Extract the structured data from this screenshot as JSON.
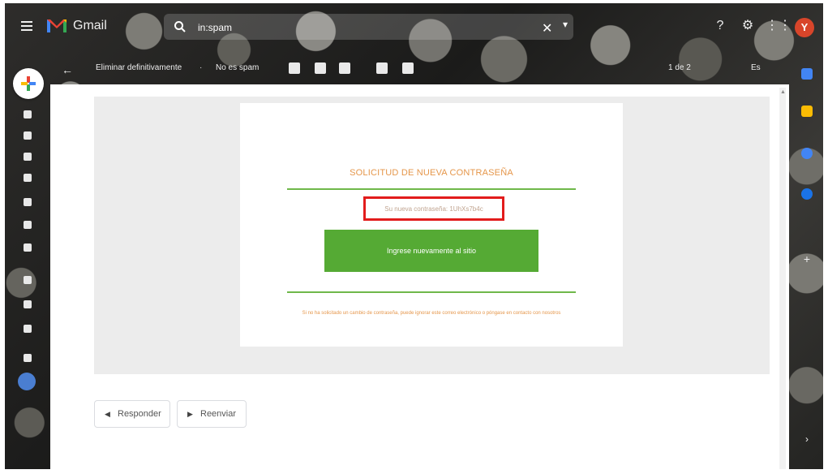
{
  "app": {
    "name": "Gmail",
    "avatar_initial": "Y"
  },
  "search": {
    "value": "in:spam"
  },
  "toolbar": {
    "label_delete": "Eliminar definitivamente",
    "label_not_spam": "No es spam",
    "count": "1 de 2",
    "lang": "Es"
  },
  "email": {
    "title": "SOLICITUD DE NUEVA CONTRASEÑA",
    "password_line": "Su nueva contraseña: 1UhXs7b4c",
    "cta_label": "Ingrese nuevamente al sitio",
    "footer_note": "Si no ha solicitado un cambio de contraseña, puede ignorar este correo electrónico o póngase en contacto con nosotros"
  },
  "actions": {
    "reply": "Responder",
    "forward": "Reenviar"
  },
  "colors": {
    "accent_orange": "#e5964a",
    "green_button": "#55aa34",
    "highlight_red": "#e21c1c",
    "avatar": "#d8452a"
  }
}
